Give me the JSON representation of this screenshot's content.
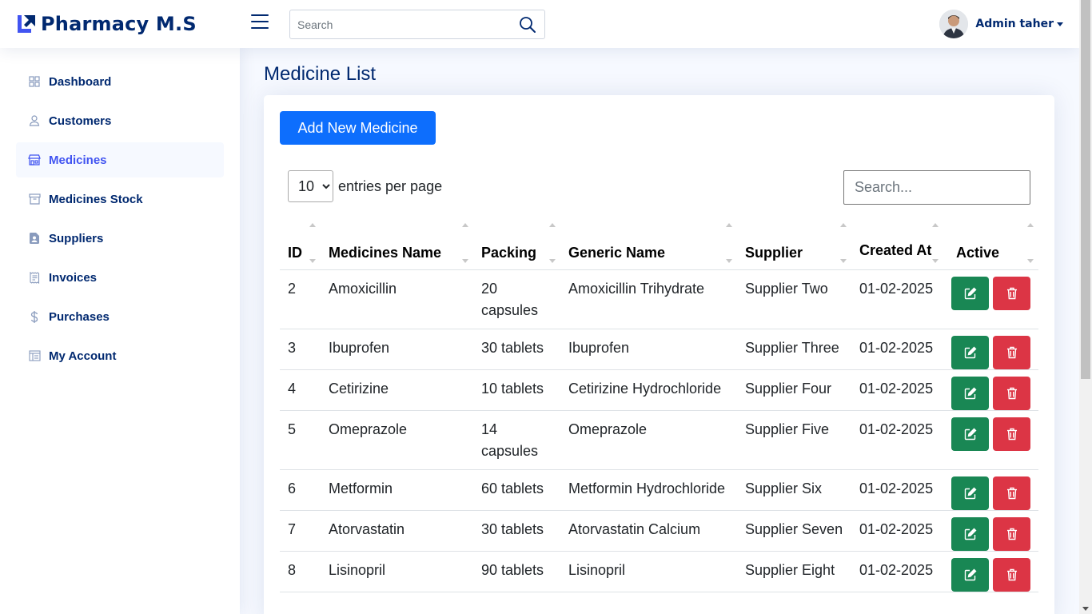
{
  "app": {
    "title": "Pharmacy M.S"
  },
  "header": {
    "search_placeholder": "Search",
    "user_name": "Admin taher"
  },
  "sidebar": {
    "items": [
      {
        "label": "Dashboard",
        "icon": "grid-icon",
        "active": false
      },
      {
        "label": "Customers",
        "icon": "person-icon",
        "active": false
      },
      {
        "label": "Medicines",
        "icon": "shop-icon",
        "active": true
      },
      {
        "label": "Medicines Stock",
        "icon": "archive-icon",
        "active": false
      },
      {
        "label": "Suppliers",
        "icon": "file-person-icon",
        "active": false
      },
      {
        "label": "Invoices",
        "icon": "receipt-icon",
        "active": false
      },
      {
        "label": "Purchases",
        "icon": "dollar-icon",
        "active": false
      },
      {
        "label": "My Account",
        "icon": "layout-icon",
        "active": false
      }
    ]
  },
  "main": {
    "page_title": "Medicine List",
    "add_button": "Add New Medicine",
    "entries_value": "10",
    "entries_label": "entries per page",
    "search_placeholder": "Search...",
    "columns": [
      "ID",
      "Medicines Name",
      "Packing",
      "Generic Name",
      "Supplier",
      "Created At",
      "Active"
    ],
    "rows": [
      {
        "id": "2",
        "name": "Amoxicillin",
        "packing": "20 capsules",
        "generic": "Amoxicillin Trihydrate",
        "supplier": "Supplier Two",
        "created": "01-02-2025"
      },
      {
        "id": "3",
        "name": "Ibuprofen",
        "packing": "30 tablets",
        "generic": "Ibuprofen",
        "supplier": "Supplier Three",
        "created": "01-02-2025"
      },
      {
        "id": "4",
        "name": "Cetirizine",
        "packing": "10 tablets",
        "generic": "Cetirizine Hydrochloride",
        "supplier": "Supplier Four",
        "created": "01-02-2025"
      },
      {
        "id": "5",
        "name": "Omeprazole",
        "packing": "14 capsules",
        "generic": "Omeprazole",
        "supplier": "Supplier Five",
        "created": "01-02-2025"
      },
      {
        "id": "6",
        "name": "Metformin",
        "packing": "60 tablets",
        "generic": "Metformin Hydrochloride",
        "supplier": "Supplier Six",
        "created": "01-02-2025"
      },
      {
        "id": "7",
        "name": "Atorvastatin",
        "packing": "30 tablets",
        "generic": "Atorvastatin Calcium",
        "supplier": "Supplier Seven",
        "created": "01-02-2025"
      },
      {
        "id": "8",
        "name": "Lisinopril",
        "packing": "90 tablets",
        "generic": "Lisinopril",
        "supplier": "Supplier Eight",
        "created": "01-02-2025"
      }
    ]
  },
  "colors": {
    "brand": "#012970",
    "accent": "#4154f1",
    "primary_button": "#0d6efd",
    "edit_button": "#198754",
    "delete_button": "#dc3545"
  }
}
